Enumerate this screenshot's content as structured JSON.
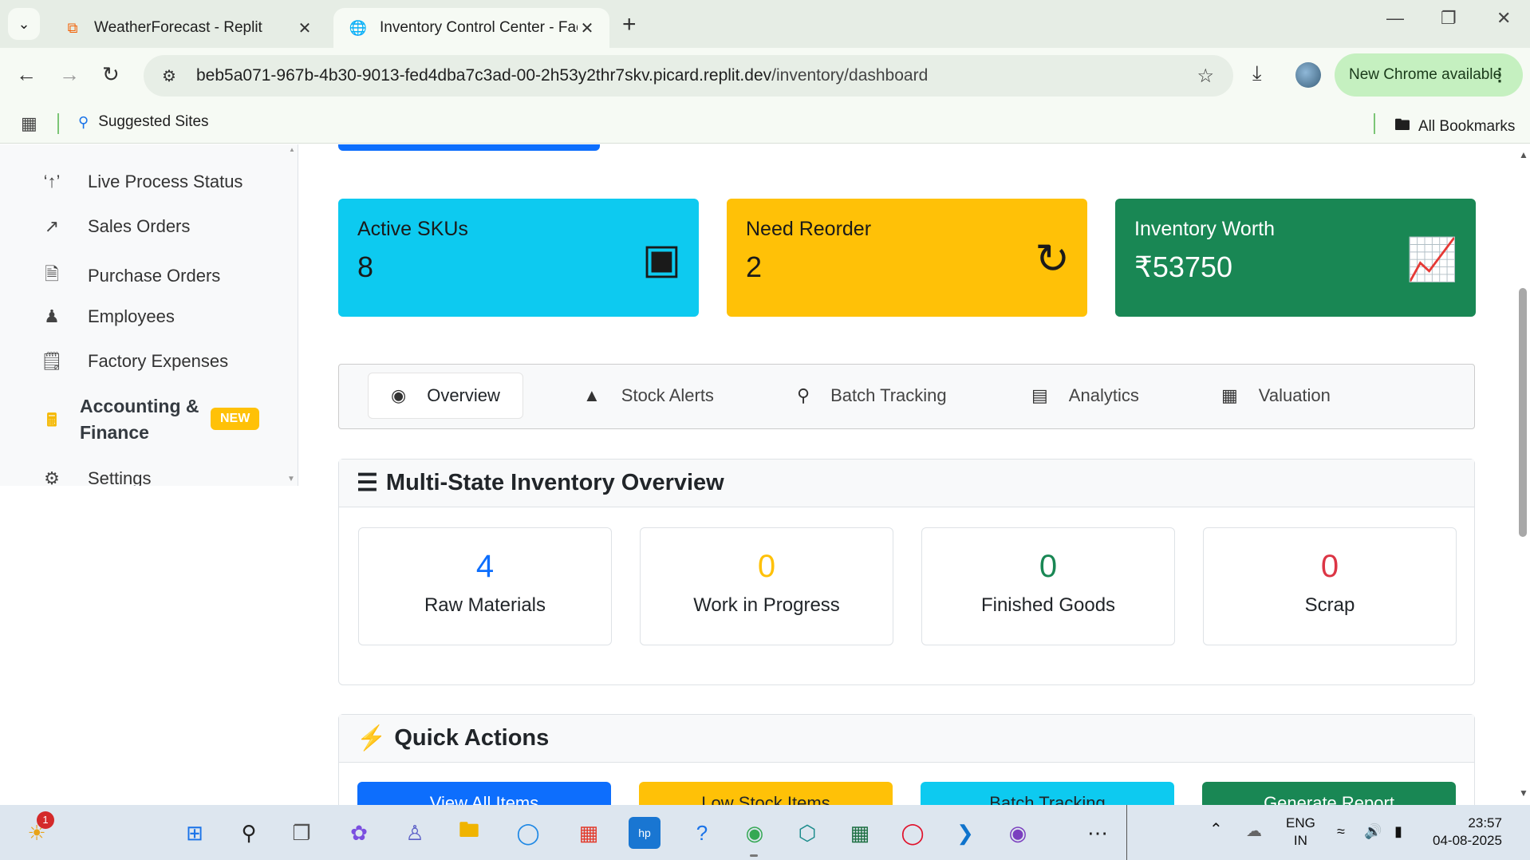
{
  "browser": {
    "tabs": [
      {
        "title": "WeatherForecast - Replit",
        "active": false
      },
      {
        "title": "Inventory Control Center - Factory",
        "active": true
      }
    ],
    "url_host": "beb5a071-967b-4b30-9013-fed4dba7c3ad-00-2h53y2thr7skv.picard.replit.dev",
    "url_path": "/inventory/dashboard",
    "update_label": "New Chrome available",
    "bookmarks": {
      "suggested": "Suggested Sites",
      "all": "All Bookmarks"
    }
  },
  "sidebar": {
    "items": [
      {
        "label": "Live Process Status",
        "icon": "broadcast-icon"
      },
      {
        "label": "Sales Orders",
        "icon": "chart-line-icon"
      },
      {
        "label": "Purchase Orders",
        "icon": "file-invoice-icon"
      },
      {
        "label": "Employees",
        "icon": "users-icon"
      },
      {
        "label": "Factory Expenses",
        "icon": "receipt-icon"
      },
      {
        "label": "Accounting &",
        "label2": "Finance",
        "icon": "calculator-icon",
        "badge": "NEW"
      },
      {
        "label": "Settings",
        "icon": "gear-icon"
      }
    ]
  },
  "stats": [
    {
      "label": "Active SKUs",
      "value": "8",
      "icon": "box-icon",
      "color": "#0dcaf0"
    },
    {
      "label": "Need Reorder",
      "value": "2",
      "icon": "refresh-icon",
      "color": "#ffc107"
    },
    {
      "label": "Inventory Worth",
      "value": "₹53750",
      "icon": "chart-line-icon",
      "color": "#198754"
    }
  ],
  "tabs": [
    {
      "label": "Overview",
      "icon": "eye-icon",
      "active": true
    },
    {
      "label": "Stock Alerts",
      "icon": "warning-icon"
    },
    {
      "label": "Batch Tracking",
      "icon": "search-icon"
    },
    {
      "label": "Analytics",
      "icon": "bar-chart-icon"
    },
    {
      "label": "Valuation",
      "icon": "calculator-icon"
    }
  ],
  "overview": {
    "title": "Multi-State Inventory Overview",
    "states": [
      {
        "value": "4",
        "label": "Raw Materials",
        "color": "#0d6efd"
      },
      {
        "value": "0",
        "label": "Work in Progress",
        "color": "#ffc107"
      },
      {
        "value": "0",
        "label": "Finished Goods",
        "color": "#198754"
      },
      {
        "value": "0",
        "label": "Scrap",
        "color": "#dc3545"
      }
    ]
  },
  "quick_actions": {
    "title": "Quick Actions",
    "buttons": [
      {
        "label": "View All Items",
        "color": "#0d6efd"
      },
      {
        "label": "Low Stock Items",
        "color": "#ffc107"
      },
      {
        "label": "Batch Tracking",
        "color": "#0dcaf0"
      },
      {
        "label": "Generate Report",
        "color": "#198754"
      }
    ]
  },
  "taskbar": {
    "notification_count": "1",
    "lang_top": "ENG",
    "lang_bottom": "IN",
    "time": "23:57",
    "date": "04-08-2025"
  }
}
